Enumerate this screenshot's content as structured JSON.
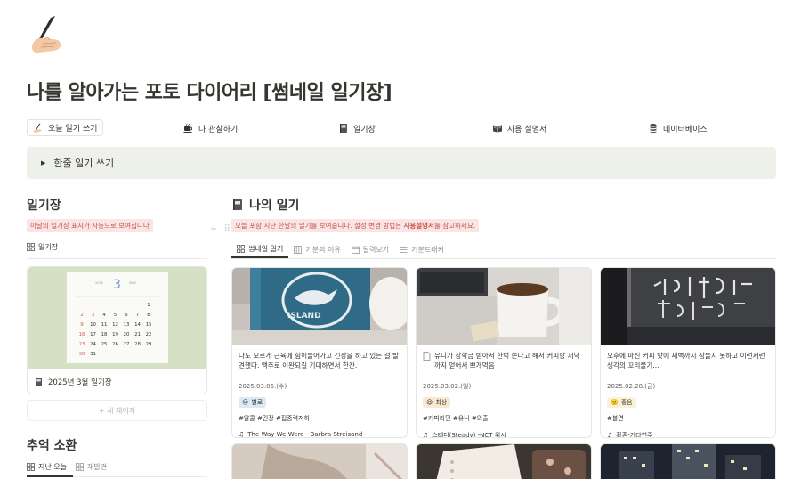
{
  "page": {
    "icon": "writing-hand-icon",
    "title": "나를 알아가는 포토 다이어리 [썸네일 일기장]"
  },
  "nav": [
    {
      "label": "오늘 일기 쓰기",
      "icon": "writing-hand-icon"
    },
    {
      "label": "나 관찰하기",
      "icon": "coffee-icon"
    },
    {
      "label": "일기장",
      "icon": "notebook-icon"
    },
    {
      "label": "사용 설명서",
      "icon": "open-book-icon"
    },
    {
      "label": "데이터베이스",
      "icon": "database-icon"
    }
  ],
  "callout": {
    "label": "한줄 일기 쓰기"
  },
  "diary_section": {
    "title": "일기장",
    "note": "이달의 일기장 표지가 자동으로 보여집니다",
    "view_label": "일기장",
    "calendar_caption": "2025년 3월 일기장",
    "new_page_label": "+ 새 페이지",
    "calendar": {
      "year": "2025",
      "month_num": "3",
      "month_name": "MAR"
    }
  },
  "memory_section": {
    "title": "추억 소환",
    "tabs": [
      "지난 오늘",
      "재발견"
    ]
  },
  "my_diary": {
    "title": "나의 일기",
    "icon": "notebook-icon",
    "note_pre": "오늘 포함 지난 한달의 일기를 보여줍니다. 설정 변경 방법은 ",
    "note_bold": "사용설명서",
    "note_post": "를 참고하세요.",
    "tabs": [
      {
        "label": "썸네일 일기",
        "icon": "gallery-icon"
      },
      {
        "label": "기분의 이유",
        "icon": "board-icon"
      },
      {
        "label": "달력보기",
        "icon": "calendar-icon"
      },
      {
        "label": "기분트래커",
        "icon": "list-icon"
      }
    ]
  },
  "cards": [
    {
      "text": "나도 모르게 근육에 힘이들어가고 긴장을 하고 있는 걸 발견했다. 액주로 이완되길 기대하면서 한잔.",
      "date": "2025.03.05.(수)",
      "mood": "별로",
      "mood_color": "#dbe9f5",
      "tags": "#알콜 #긴장 #집중력저하",
      "song": "The Way We Were - Barbra Streisand",
      "has_doc_icon": false
    },
    {
      "text": "유니가 장학금 받아서 한턱 쏜다고 해서 커피랑 저녁까지 얻어서 뽀개먹음",
      "date": "2025.03.02.(일)",
      "mood": "최상",
      "mood_color": "#fae7d1",
      "tags": "#커피라던 #유니 #외출",
      "song": "스테디(Steady) -NCT 위시",
      "has_doc_icon": true
    },
    {
      "text": "오후에 마신 커피 탓에 새벽까지 잠들지 못하고 이런저런 생각의 꼬리물기...",
      "date": "2025.02.28.(금)",
      "mood": "좋음",
      "mood_color": "#fbf1d6",
      "tags": "#불면",
      "song": "황혼-기타연주",
      "has_doc_icon": false
    }
  ]
}
